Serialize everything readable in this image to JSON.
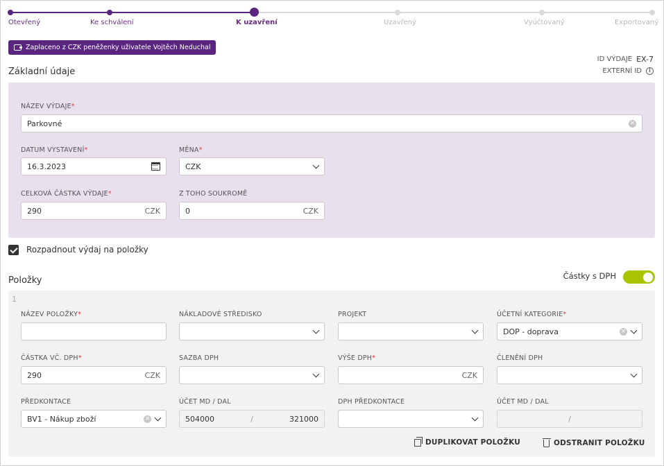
{
  "stepper": {
    "steps": [
      {
        "label": "Otevřený",
        "state": "done"
      },
      {
        "label": "Ke schválení",
        "state": "done"
      },
      {
        "label": "K uzavření",
        "state": "current"
      },
      {
        "label": "Uzavřený",
        "state": "todo"
      },
      {
        "label": "Vyúčtovaný",
        "state": "todo"
      },
      {
        "label": "Exportovaný",
        "state": "todo"
      }
    ]
  },
  "paid_badge": {
    "label": "Zaplaceno z CZK peněženky uživatele Vojtěch Neduchal",
    "icon": "wallet-icon"
  },
  "meta": {
    "id_label": "ID VÝDAJE",
    "id_value": "EX-7",
    "external_id_label": "EXTERNÍ ID"
  },
  "basic": {
    "title": "Základní údaje",
    "name_label": "NÁZEV VÝDAJE",
    "name_value": "Parkovné",
    "date_label": "DATUM VYSTAVENÍ",
    "date_value": "16.3.2023",
    "currency_label": "MĚNA",
    "currency_value": "CZK",
    "total_label": "CELKOVÁ ČÁSTKA VÝDAJE",
    "total_value": "290",
    "total_suffix": "CZK",
    "private_label": "Z TOHO SOUKROMĚ",
    "private_value": "0",
    "private_suffix": "CZK"
  },
  "split": {
    "label": "Rozpadnout výdaj na položky",
    "checked": true
  },
  "items": {
    "title": "Položky",
    "vat_toggle_label": "Částky s DPH",
    "vat_toggle_on": true,
    "item_number": "1",
    "item_name_label": "NÁZEV POLOŽKY",
    "item_name_value": "",
    "cost_center_label": "NÁKLADOVÉ STŘEDISKO",
    "cost_center_value": "",
    "project_label": "PROJEKT",
    "project_value": "",
    "category_label": "ÚČETNÍ KATEGORIE",
    "category_value": "DOP - doprava",
    "amount_label": "ČÁSTKA VČ. DPH",
    "amount_value": "290",
    "amount_suffix": "CZK",
    "vat_rate_label": "SAZBA DPH",
    "vat_rate_value": "",
    "vat_amount_label": "VÝŠE DPH",
    "vat_amount_value": "",
    "vat_amount_suffix": "CZK",
    "vat_split_label": "ČLENĚNÍ DPH",
    "vat_split_value": "",
    "precontact_label": "PŘEDKONTACE",
    "precontact_value": "BV1 - Nákup zboží",
    "account_label": "ÚČET MD / DAL",
    "account_md": "504000",
    "account_dal": "321000",
    "account_slash": "/",
    "vat_precontact_label": "DPH PŘEDKONTACE",
    "vat_precontact_value": "",
    "vat_account_label": "ÚČET MD / DAL",
    "vat_account_md": "",
    "vat_account_dal": "",
    "vat_account_slash": "/",
    "duplicate_label": "DUPLIKOVAT POLOŽKU",
    "remove_label": "ODSTRANIT POLOŽKU"
  },
  "colors": {
    "accent": "#5a2580",
    "toggle": "#a9c400",
    "panel_basic": "#e9e0ee",
    "panel_items": "#f2f2f0"
  }
}
